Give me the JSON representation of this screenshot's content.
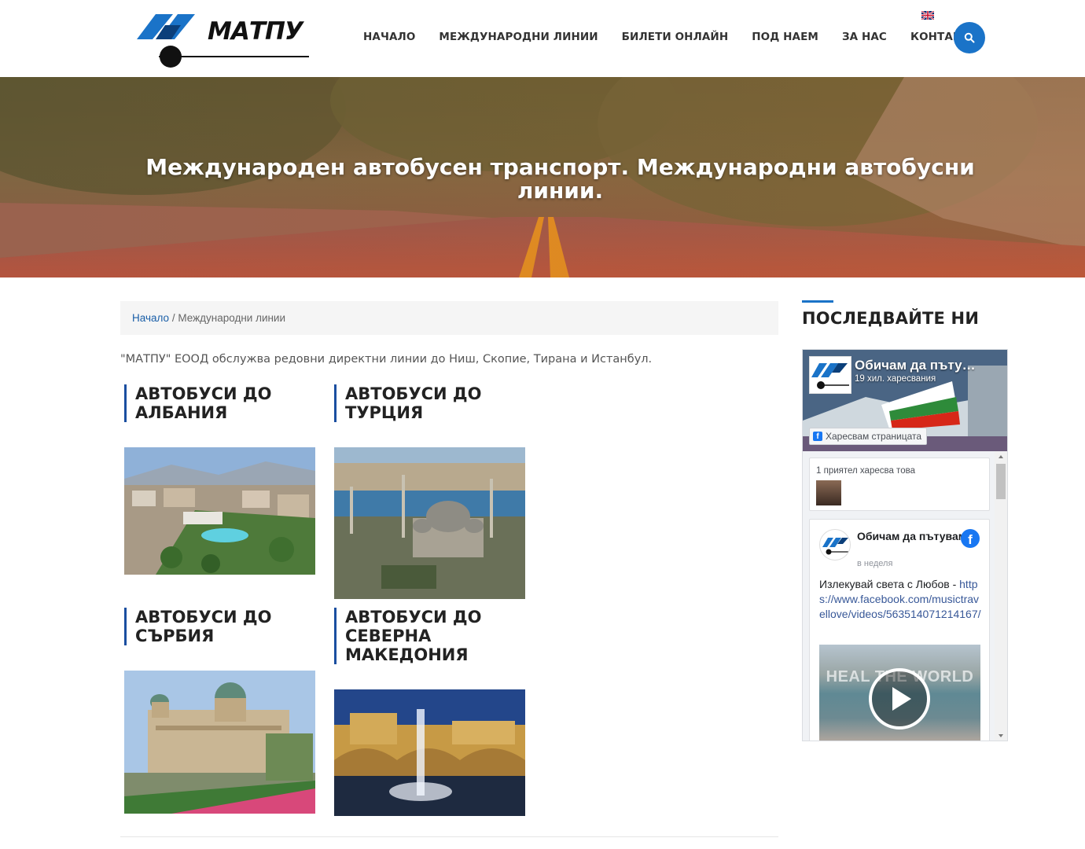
{
  "brand": {
    "name": "МАТПУ"
  },
  "nav": [
    "НАЧАЛО",
    "МЕЖДУНАРОДНИ ЛИНИИ",
    "БИЛЕТИ ОНЛАЙН",
    "ПОД НАЕМ",
    "ЗА НАС",
    "КОНТАКТИ"
  ],
  "header": {
    "language_icon": "uk-flag-icon",
    "search_icon": "search-icon",
    "accent_color": "#1a73c8"
  },
  "hero": {
    "title": "Международен автобусен транспорт. Международни автобусни линии."
  },
  "breadcrumb": {
    "home": "Начало",
    "separator": "/",
    "current": "Международни линии"
  },
  "intro": "\"МАТПУ\" ЕООД обслужва редовни директни линии до Ниш, Скопие, Тирана и Истанбул.",
  "cards": [
    {
      "title": "АВТОБУСИ ДО АЛБАНИЯ"
    },
    {
      "title": "АВТОБУСИ ДО ТУРЦИЯ"
    },
    {
      "title": "АВТОБУСИ ДО СЪРБИЯ"
    },
    {
      "title": "АВТОБУСИ ДО СЕВЕРНА МАКЕДОНИЯ"
    }
  ],
  "sidebar": {
    "title": "ПОСЛЕДВАЙТЕ НИ",
    "facebook": {
      "page_name": "Обичам да пъту…",
      "likes": "19 хил. харесвания",
      "like_button": "Харесвам страницата",
      "friend_text": "1 приятел харесва това",
      "post": {
        "author": "Обичам да пътувам",
        "time": "в неделя",
        "text": "Излекувай света с Любов -",
        "link": "https://www.facebook.com/musictravellove/videos/563514071214167/",
        "video_title": "HEAL THE WORLD"
      }
    }
  }
}
